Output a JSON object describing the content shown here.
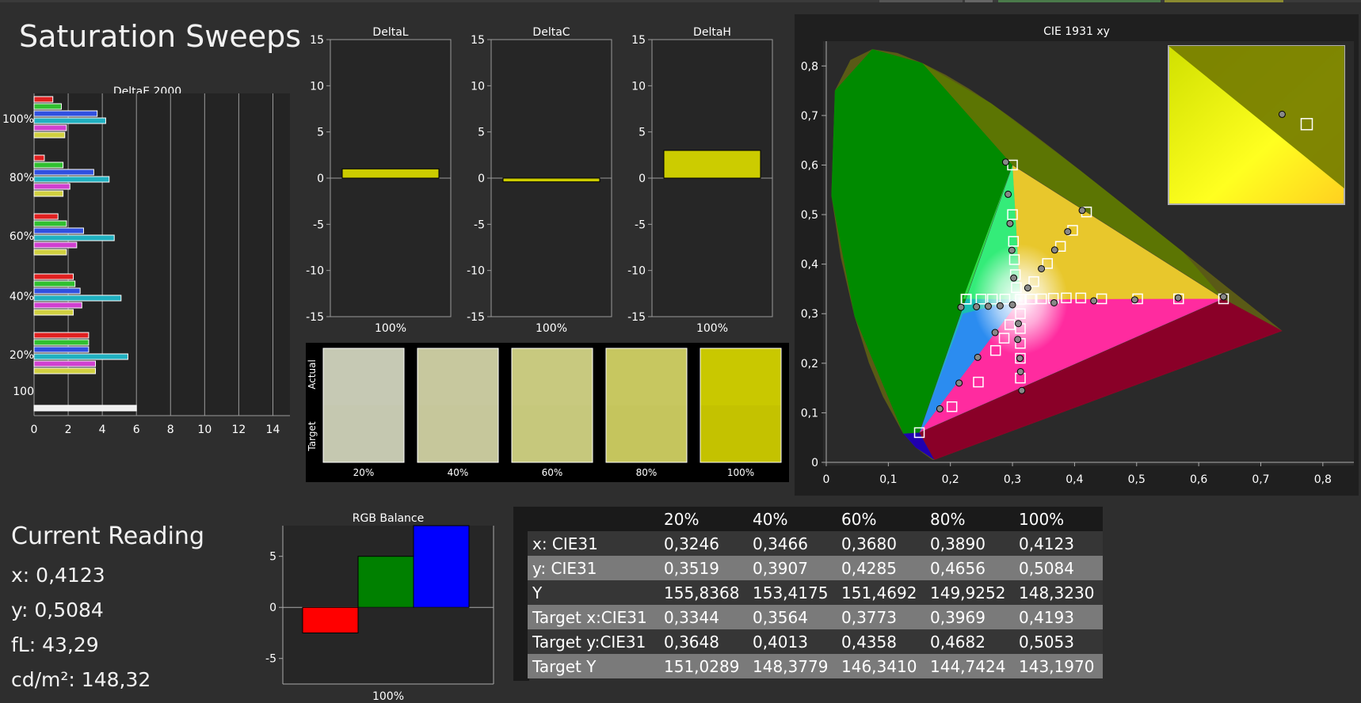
{
  "page": {
    "title": "Saturation Sweeps",
    "colors": {
      "background": "#2e2e2e",
      "panel": "#232323",
      "yellow": "#cccc00"
    }
  },
  "current_reading": {
    "heading": "Current Reading",
    "x": "x: 0,4123",
    "y": "y: 0,5084",
    "fl": "fL: 43,29",
    "cdm2": "cd/m²: 148,32"
  },
  "table": {
    "headers": [
      "",
      "20%",
      "40%",
      "60%",
      "80%",
      "100%"
    ],
    "rows": [
      {
        "label": "x: CIE31",
        "values": [
          "0,3246",
          "0,3466",
          "0,3680",
          "0,3890",
          "0,4123"
        ]
      },
      {
        "label": "y: CIE31",
        "values": [
          "0,3519",
          "0,3907",
          "0,4285",
          "0,4656",
          "0,5084"
        ]
      },
      {
        "label": "Y",
        "values": [
          "155,8368",
          "153,4175",
          "151,4692",
          "149,9252",
          "148,3230"
        ]
      },
      {
        "label": "Target x:CIE31",
        "values": [
          "0,3344",
          "0,3564",
          "0,3773",
          "0,3969",
          "0,4193"
        ]
      },
      {
        "label": "Target y:CIE31",
        "values": [
          "0,3648",
          "0,4013",
          "0,4358",
          "0,4682",
          "0,5053"
        ]
      },
      {
        "label": "Target Y",
        "values": [
          "151,0289",
          "148,3779",
          "146,3410",
          "144,7424",
          "143,1970"
        ]
      }
    ]
  },
  "chart_data": [
    {
      "id": "deltae",
      "type": "bar",
      "title": "DeltaE 2000",
      "orientation": "horizontal",
      "xlim": [
        0,
        15
      ],
      "xticks": [
        "0",
        "2",
        "4",
        "6",
        "8",
        "10",
        "12",
        "14"
      ],
      "group_labels": [
        "100%",
        "80%",
        "60%",
        "40%",
        "20%",
        "100"
      ],
      "series_colors": [
        "#e02020",
        "#30c030",
        "#3050e0",
        "#20b0c0",
        "#d040d0",
        "#d0d040"
      ],
      "groups": [
        {
          "label": "100%",
          "values": [
            1.1,
            1.6,
            3.7,
            4.2,
            1.9,
            1.8
          ]
        },
        {
          "label": "80%",
          "values": [
            0.6,
            1.7,
            3.5,
            4.4,
            2.1,
            1.7
          ]
        },
        {
          "label": "60%",
          "values": [
            1.4,
            1.9,
            2.9,
            4.7,
            2.5,
            1.9
          ]
        },
        {
          "label": "40%",
          "values": [
            2.3,
            2.4,
            2.7,
            5.1,
            2.8,
            2.3
          ]
        },
        {
          "label": "20%",
          "values": [
            3.2,
            3.2,
            3.2,
            5.5,
            3.6,
            3.6
          ]
        },
        {
          "label": "100",
          "values": [
            6.0
          ]
        }
      ]
    },
    {
      "id": "deltal",
      "type": "bar",
      "title": "DeltaL",
      "categories": [
        "100%"
      ],
      "values": [
        1.0
      ],
      "ylim": [
        -15,
        15
      ],
      "yticks": [
        "15",
        "10",
        "5",
        "0",
        "-5",
        "-10",
        "-15"
      ]
    },
    {
      "id": "deltac",
      "type": "bar",
      "title": "DeltaC",
      "categories": [
        "100%"
      ],
      "values": [
        -0.4
      ],
      "ylim": [
        -15,
        15
      ],
      "yticks": [
        "15",
        "10",
        "5",
        "0",
        "-5",
        "-10",
        "-15"
      ]
    },
    {
      "id": "deltah",
      "type": "bar",
      "title": "DeltaH",
      "categories": [
        "100%"
      ],
      "values": [
        3.0
      ],
      "ylim": [
        -15,
        15
      ],
      "yticks": [
        "15",
        "10",
        "5",
        "0",
        "-5",
        "-10",
        "-15"
      ]
    },
    {
      "id": "swatches",
      "type": "table",
      "row_labels": [
        "Actual",
        "Target"
      ],
      "categories": [
        "20%",
        "40%",
        "60%",
        "80%",
        "100%"
      ],
      "actual_colors": [
        "#c6c9b4",
        "#c7c89e",
        "#c8c97f",
        "#c7c760",
        "#c9c800"
      ],
      "target_colors": [
        "#c5c8b0",
        "#c6c79b",
        "#c6c87c",
        "#c5c55d",
        "#c4c200"
      ]
    },
    {
      "id": "cie",
      "type": "scatter",
      "title": "CIE 1931 xy",
      "xlim": [
        0,
        0.85
      ],
      "ylim": [
        0,
        0.85
      ],
      "xticks": [
        "0",
        "0,1",
        "0,2",
        "0,3",
        "0,4",
        "0,5",
        "0,6",
        "0,7",
        "0,8"
      ],
      "yticks": [
        "0",
        "0,1",
        "0,2",
        "0,3",
        "0,4",
        "0,5",
        "0,6",
        "0,7",
        "0,8"
      ],
      "gamut": [
        [
          0.64,
          0.33
        ],
        [
          0.3,
          0.6
        ],
        [
          0.15,
          0.06
        ]
      ],
      "white_point": [
        0.3127,
        0.329
      ],
      "targets": [
        [
          0.3127,
          0.329
        ],
        [
          0.3295,
          0.3295
        ],
        [
          0.3468,
          0.33
        ],
        [
          0.3658,
          0.3312
        ],
        [
          0.3867,
          0.3318
        ],
        [
          0.4101,
          0.3317
        ],
        [
          0.4437,
          0.33
        ],
        [
          0.5017,
          0.33
        ],
        [
          0.5676,
          0.33
        ],
        [
          0.64,
          0.33
        ],
        [
          0.3062,
          0.3526
        ],
        [
          0.3046,
          0.3788
        ],
        [
          0.3031,
          0.4091
        ],
        [
          0.3016,
          0.446
        ],
        [
          0.3,
          0.5
        ],
        [
          0.3,
          0.6
        ],
        [
          0.2878,
          0.3295
        ],
        [
          0.2676,
          0.3295
        ],
        [
          0.2494,
          0.3295
        ],
        [
          0.2257,
          0.3293
        ],
        [
          0.2251,
          0.3295
        ],
        [
          0.2958,
          0.2779
        ],
        [
          0.2866,
          0.2506
        ],
        [
          0.2727,
          0.2258
        ],
        [
          0.245,
          0.162
        ],
        [
          0.2025,
          0.1123
        ],
        [
          0.15,
          0.06
        ],
        [
          0.3127,
          0.3
        ],
        [
          0.3127,
          0.27
        ],
        [
          0.3127,
          0.24
        ],
        [
          0.3127,
          0.21
        ],
        [
          0.3127,
          0.17
        ],
        [
          0.3344,
          0.3648
        ],
        [
          0.3564,
          0.4013
        ],
        [
          0.3773,
          0.4358
        ],
        [
          0.3969,
          0.4682
        ],
        [
          0.4193,
          0.5053
        ]
      ],
      "measured": [
        [
          0.3246,
          0.3519
        ],
        [
          0.3466,
          0.3907
        ],
        [
          0.368,
          0.4285
        ],
        [
          0.389,
          0.4656
        ],
        [
          0.4123,
          0.5084
        ],
        [
          0.302,
          0.372
        ],
        [
          0.299,
          0.428
        ],
        [
          0.296,
          0.482
        ],
        [
          0.293,
          0.541
        ],
        [
          0.289,
          0.606
        ],
        [
          0.367,
          0.322
        ],
        [
          0.431,
          0.326
        ],
        [
          0.497,
          0.328
        ],
        [
          0.567,
          0.332
        ],
        [
          0.64,
          0.334
        ],
        [
          0.3,
          0.318
        ],
        [
          0.28,
          0.316
        ],
        [
          0.261,
          0.315
        ],
        [
          0.242,
          0.314
        ],
        [
          0.217,
          0.313
        ],
        [
          0.3095,
          0.28
        ],
        [
          0.3085,
          0.248
        ],
        [
          0.312,
          0.21
        ],
        [
          0.313,
          0.183
        ],
        [
          0.315,
          0.145
        ],
        [
          0.272,
          0.262
        ],
        [
          0.244,
          0.212
        ],
        [
          0.214,
          0.16
        ],
        [
          0.183,
          0.108
        ]
      ],
      "inset_target": [
        0.4193,
        0.5053
      ],
      "inset_measured": [
        0.4123,
        0.5084
      ]
    },
    {
      "id": "rgb",
      "type": "bar",
      "title": "RGB Balance",
      "categories": [
        "100%"
      ],
      "series": [
        {
          "color": "#ff0000",
          "values": [
            -2.5
          ]
        },
        {
          "color": "#008000",
          "values": [
            5.0
          ]
        },
        {
          "color": "#0000ff",
          "values": [
            8.0
          ]
        }
      ],
      "ylim": [
        -7.5,
        8
      ],
      "yticks": [
        "5",
        "0",
        "-5"
      ]
    }
  ]
}
